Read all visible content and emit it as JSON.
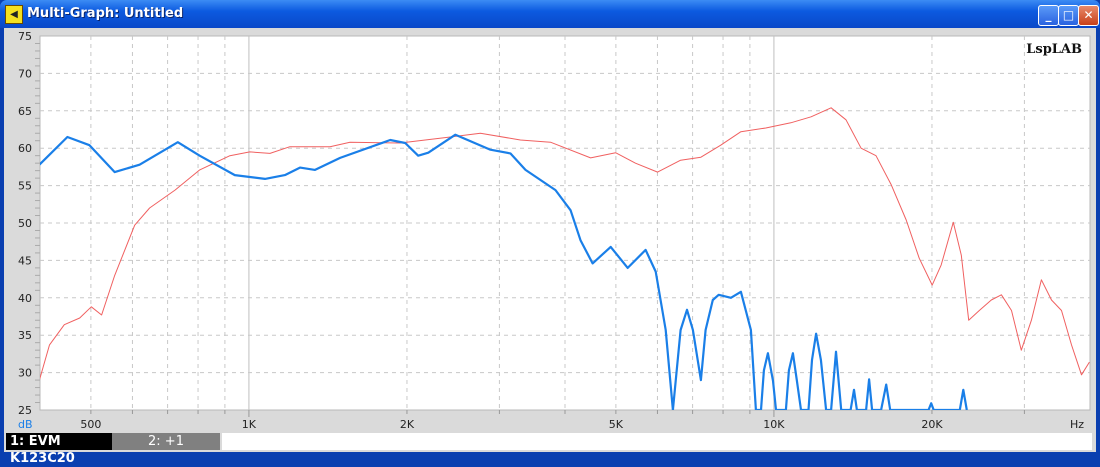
{
  "window": {
    "title": "Multi-Graph: Untitled",
    "minimize": "_",
    "maximize": "□",
    "close": "✕",
    "icon": "speaker-icon"
  },
  "brand": "LspLAB",
  "legend": [
    {
      "label": "1: EVM K123C20"
    },
    {
      "label": "2: +1"
    }
  ],
  "chart_data": {
    "type": "line",
    "title": "",
    "xlabel": "Hz",
    "ylabel": "dB",
    "xscale": "log",
    "xlim": [
      400,
      40000
    ],
    "ylim": [
      25,
      75
    ],
    "grid": true,
    "x_ticks": [
      {
        "v": 500,
        "label": "500"
      },
      {
        "v": 1000,
        "label": "1K"
      },
      {
        "v": 2000,
        "label": "2K"
      },
      {
        "v": 5000,
        "label": "5K"
      },
      {
        "v": 10000,
        "label": "10K"
      },
      {
        "v": 20000,
        "label": "20K"
      }
    ],
    "y_ticks": [
      25,
      30,
      35,
      40,
      45,
      50,
      55,
      60,
      65,
      70,
      75
    ],
    "series": [
      {
        "name": "1: EVM K123C20",
        "color": "#1a7fe8",
        "points": [
          [
            399,
            57.8
          ],
          [
            451,
            61.5
          ],
          [
            497,
            60.4
          ],
          [
            555,
            56.8
          ],
          [
            619,
            57.8
          ],
          [
            732,
            60.8
          ],
          [
            806,
            59
          ],
          [
            940,
            56.4
          ],
          [
            1073,
            55.9
          ],
          [
            1171,
            56.4
          ],
          [
            1251,
            57.4
          ],
          [
            1336,
            57.1
          ],
          [
            1492,
            58.7
          ],
          [
            1858,
            61.1
          ],
          [
            1985,
            60.7
          ],
          [
            2101,
            59
          ],
          [
            2196,
            59.4
          ],
          [
            2473,
            61.8
          ],
          [
            2884,
            59.8
          ],
          [
            3148,
            59.3
          ],
          [
            3363,
            57.1
          ],
          [
            3837,
            54.4
          ],
          [
            4100,
            51.7
          ],
          [
            4282,
            47.7
          ],
          [
            4514,
            44.6
          ],
          [
            4887,
            46.8
          ],
          [
            5266,
            44
          ],
          [
            5696,
            46.4
          ],
          [
            5955,
            43.5
          ],
          [
            6220,
            35.7
          ],
          [
            6420,
            25
          ],
          [
            6640,
            35.7
          ],
          [
            6830,
            38.4
          ],
          [
            7010,
            35.7
          ],
          [
            7260,
            29
          ],
          [
            7410,
            35.7
          ],
          [
            7650,
            39.7
          ],
          [
            7850,
            40.4
          ],
          [
            8280,
            40
          ],
          [
            8650,
            40.8
          ],
          [
            9040,
            35.7
          ],
          [
            9240,
            25
          ],
          [
            9450,
            25
          ],
          [
            9570,
            30.3
          ],
          [
            9740,
            32.6
          ],
          [
            9960,
            28.9
          ],
          [
            10090,
            25
          ],
          [
            10540,
            25
          ],
          [
            10680,
            30.3
          ],
          [
            10870,
            32.6
          ],
          [
            11060,
            28.9
          ],
          [
            11260,
            25
          ],
          [
            11640,
            25
          ],
          [
            11820,
            31.7
          ],
          [
            12030,
            35.2
          ],
          [
            12290,
            31.7
          ],
          [
            12570,
            25
          ],
          [
            12850,
            25
          ],
          [
            13130,
            32.8
          ],
          [
            13430,
            25
          ],
          [
            14000,
            25
          ],
          [
            14210,
            27.7
          ],
          [
            14390,
            25
          ],
          [
            14980,
            25
          ],
          [
            15180,
            29.1
          ],
          [
            15380,
            25
          ],
          [
            16000,
            25
          ],
          [
            16360,
            28.4
          ],
          [
            16650,
            25
          ],
          [
            19700,
            25
          ],
          [
            19930,
            25.9
          ],
          [
            20150,
            25
          ],
          [
            22600,
            25
          ],
          [
            22950,
            27.7
          ],
          [
            23300,
            25
          ]
        ]
      },
      {
        "name": "2: +1",
        "color": "#f06060",
        "points": [
          [
            399,
            29
          ],
          [
            417,
            33.7
          ],
          [
            445,
            36.4
          ],
          [
            476,
            37.3
          ],
          [
            501,
            38.8
          ],
          [
            524,
            37.7
          ],
          [
            555,
            43
          ],
          [
            606,
            49.7
          ],
          [
            647,
            52
          ],
          [
            723,
            54.4
          ],
          [
            806,
            57.1
          ],
          [
            920,
            59
          ],
          [
            1004,
            59.5
          ],
          [
            1097,
            59.3
          ],
          [
            1197,
            60.2
          ],
          [
            1427,
            60.2
          ],
          [
            1558,
            60.8
          ],
          [
            1942,
            60.7
          ],
          [
            2419,
            61.5
          ],
          [
            2760,
            62
          ],
          [
            3289,
            61.1
          ],
          [
            3753,
            60.8
          ],
          [
            4475,
            58.7
          ],
          [
            4994,
            59.4
          ],
          [
            5450,
            58
          ],
          [
            6005,
            56.8
          ],
          [
            6640,
            58.4
          ],
          [
            7260,
            58.8
          ],
          [
            7920,
            60.4
          ],
          [
            8650,
            62.2
          ],
          [
            9650,
            62.7
          ],
          [
            10770,
            63.4
          ],
          [
            11770,
            64.2
          ],
          [
            12850,
            65.4
          ],
          [
            13720,
            63.8
          ],
          [
            14660,
            60
          ],
          [
            15650,
            59
          ],
          [
            16730,
            55.1
          ],
          [
            17860,
            50.4
          ],
          [
            18910,
            45.3
          ],
          [
            20020,
            41.7
          ],
          [
            20830,
            44.4
          ],
          [
            21960,
            50.1
          ],
          [
            22750,
            45.7
          ],
          [
            23500,
            37
          ],
          [
            24620,
            38.3
          ],
          [
            25950,
            39.7
          ],
          [
            27120,
            40.4
          ],
          [
            28350,
            38.3
          ],
          [
            29600,
            33
          ],
          [
            30940,
            37
          ],
          [
            32320,
            42.4
          ],
          [
            33790,
            39.7
          ],
          [
            35300,
            38.3
          ],
          [
            36880,
            33.7
          ],
          [
            38540,
            29.7
          ],
          [
            39900,
            31.4
          ]
        ]
      }
    ]
  }
}
